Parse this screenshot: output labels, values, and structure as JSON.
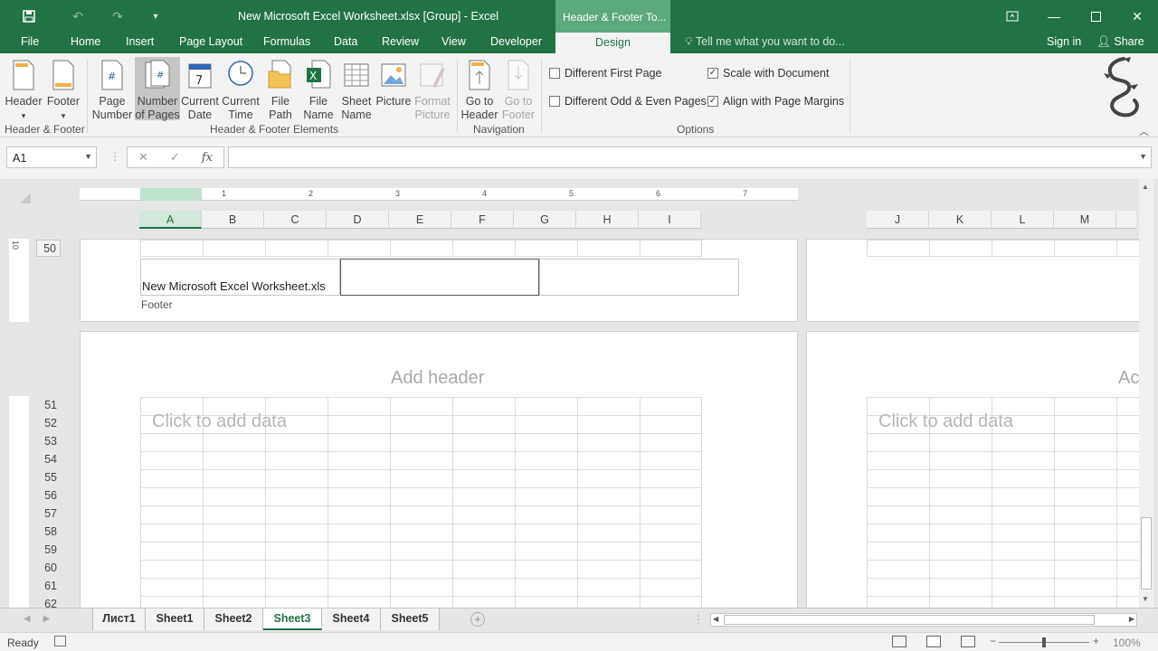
{
  "titlebar": {
    "title": "New Microsoft Excel Worksheet.xlsx  [Group] - Excel",
    "context_title": "Header & Footer To...",
    "qat_save": "save-icon",
    "qat_undo": "undo-icon",
    "qat_redo": "redo-icon",
    "qat_customize": "customize-icon"
  },
  "tabs": {
    "file": "File",
    "home": "Home",
    "insert": "Insert",
    "page_layout": "Page Layout",
    "formulas": "Formulas",
    "data": "Data",
    "review": "Review",
    "view": "View",
    "developer": "Developer",
    "design": "Design",
    "tell_me": "Tell me what you want to do...",
    "sign_in": "Sign in",
    "share": "Share"
  },
  "ribbon": {
    "header": "Header",
    "footer": "Footer",
    "page_number_1": "Page",
    "page_number_2": "Number",
    "num_pages_1": "Number",
    "num_pages_2": "of Pages",
    "cur_date_1": "Current",
    "cur_date_2": "Date",
    "cur_time_1": "Current",
    "cur_time_2": "Time",
    "file_path_1": "File",
    "file_path_2": "Path",
    "file_name_1": "File",
    "file_name_2": "Name",
    "sheet_name_1": "Sheet",
    "sheet_name_2": "Name",
    "picture": "Picture",
    "format_picture_1": "Format",
    "format_picture_2": "Picture",
    "goto_header_1": "Go to",
    "goto_header_2": "Header",
    "goto_footer_1": "Go to",
    "goto_footer_2": "Footer",
    "group_hf": "Header & Footer",
    "group_elements": "Header & Footer Elements",
    "group_nav": "Navigation",
    "group_options": "Options",
    "opt_diff_first": "Different First Page",
    "opt_diff_oddeven": "Different Odd & Even Pages",
    "opt_scale": "Scale with Document",
    "opt_align": "Align with Page Margins",
    "opt_diff_first_checked": false,
    "opt_diff_oddeven_checked": false,
    "opt_scale_checked": true,
    "opt_align_checked": true
  },
  "formula_bar": {
    "name_box": "A1",
    "value": ""
  },
  "sheet": {
    "columns_left": [
      "A",
      "B",
      "C",
      "D",
      "E",
      "F",
      "G",
      "H",
      "I"
    ],
    "columns_right": [
      "J",
      "K",
      "L",
      "M"
    ],
    "ruler_numbers": [
      "1",
      "2",
      "3",
      "4",
      "5",
      "6",
      "7"
    ],
    "vruler_number": "10",
    "top_row": "50",
    "rows": [
      "51",
      "52",
      "53",
      "54",
      "55",
      "56",
      "57",
      "58",
      "59",
      "60",
      "61",
      "62"
    ],
    "footer_left_text": "New Microsoft Excel Worksheet.xls",
    "footer_label": "Footer",
    "add_header": "Add header",
    "add_header_right": "Ac",
    "click_to_add": "Click to add data",
    "click_to_add_right": "Click to add data"
  },
  "sheet_tabs": [
    "Лист1",
    "Sheet1",
    "Sheet2",
    "Sheet3",
    "Sheet4",
    "Sheet5"
  ],
  "active_sheet": "Sheet3",
  "status": {
    "ready": "Ready",
    "zoom": "100%"
  },
  "colors": {
    "accent": "#217346",
    "context": "#5ba97d"
  }
}
